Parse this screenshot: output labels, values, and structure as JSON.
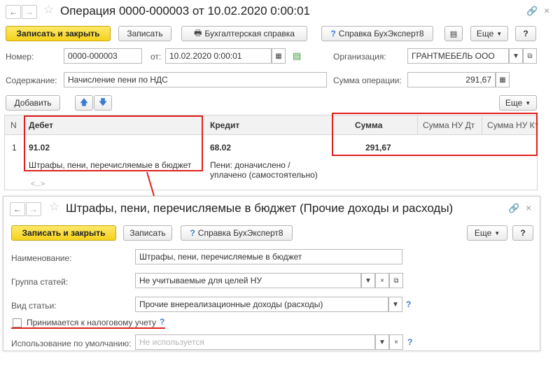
{
  "main": {
    "title": "Операция 0000-000003 от 10.02.2020 0:00:01",
    "toolbar": {
      "save_close": "Записать и закрыть",
      "save": "Записать",
      "accounting_ref": "Бухгалтерская справка",
      "expert_help": "Справка БухЭксперт8",
      "more": "Еще",
      "help": "?"
    },
    "number_label": "Номер:",
    "number_value": "0000-000003",
    "from_label": "от:",
    "date_value": "10.02.2020  0:00:01",
    "org_label": "Организация:",
    "org_value": "ГРАНТМЕБЕЛЬ ООО",
    "content_label": "Содержание:",
    "content_value": "Начисление пени по НДС",
    "sum_label": "Сумма операции:",
    "sum_value": "291,67",
    "add_button": "Добавить",
    "more_button": "Еще",
    "table": {
      "headers": {
        "n": "N",
        "debit": "Дебет",
        "credit": "Кредит",
        "sum": "Сумма",
        "sum_nu_dt": "Сумма НУ Дт",
        "sum_nu_kt": "Сумма НУ Кт"
      },
      "row": {
        "n": "1",
        "debit_account": "91.02",
        "debit_sub": "Штрафы, пени, перечисляемые в бюджет",
        "credit_account": "68.02",
        "credit_sub_1": "Пени: доначислено /",
        "credit_sub_2": "уплачено (самостоятельно)",
        "sum": "291,67",
        "ellipsis": "<...>"
      }
    }
  },
  "sub": {
    "title": "Штрафы, пени, перечисляемые в бюджет (Прочие доходы и расходы)",
    "toolbar": {
      "save_close": "Записать и закрыть",
      "save": "Записать",
      "expert_help": "Справка БухЭксперт8",
      "more": "Еще",
      "help": "?"
    },
    "name_label": "Наименование:",
    "name_value": "Штрафы, пени, перечисляемые в бюджет",
    "group_label": "Группа статей:",
    "group_value": "Не учитываемые для целей НУ",
    "kind_label": "Вид статьи:",
    "kind_value": "Прочие внереализационные доходы (расходы)",
    "tax_checkbox_label": "Принимается к налоговому учету",
    "default_label": "Использование по умолчанию:",
    "default_placeholder": "Не используется"
  }
}
